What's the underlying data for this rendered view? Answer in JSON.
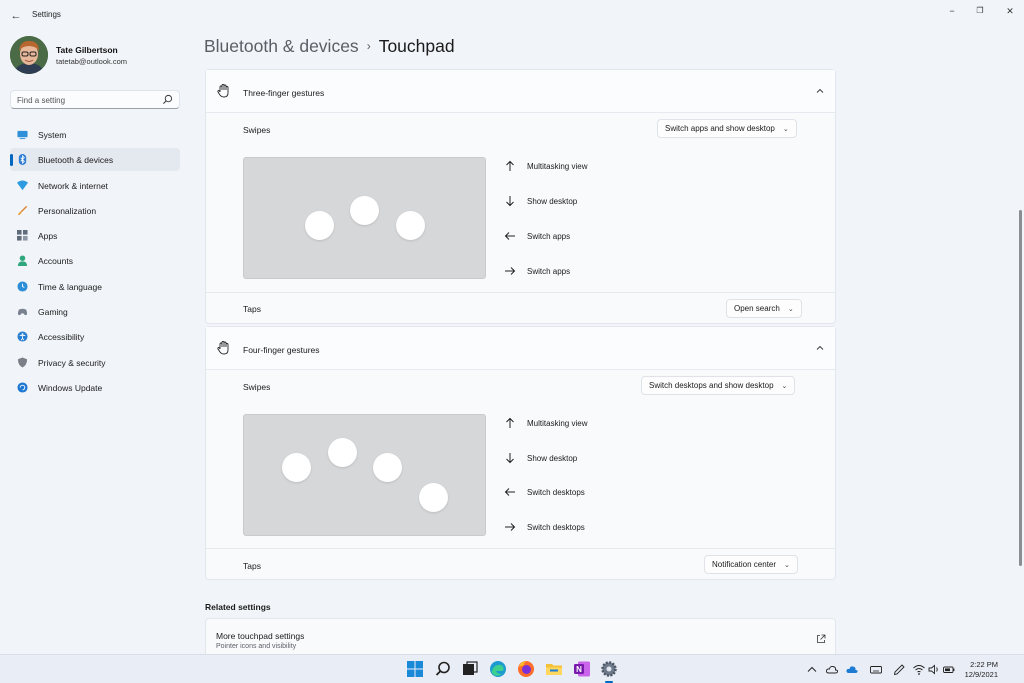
{
  "window": {
    "title": "Settings",
    "back_glyph": "←",
    "minimize_glyph": "−",
    "maximize_glyph": "❐",
    "close_glyph": "✕"
  },
  "profile": {
    "name": "Tate Gilbertson",
    "email": "tatetab@outlook.com"
  },
  "search": {
    "placeholder": "Find a setting"
  },
  "sidebar": {
    "items": [
      {
        "label": "System",
        "icon": "system-icon",
        "color": "#2f8fd8"
      },
      {
        "label": "Bluetooth & devices",
        "icon": "bluetooth-icon",
        "color": "#2b7bd4",
        "active": true
      },
      {
        "label": "Network & internet",
        "icon": "network-icon",
        "color": "#2e9be0"
      },
      {
        "label": "Personalization",
        "icon": "brush-icon",
        "color": "#d9822b"
      },
      {
        "label": "Apps",
        "icon": "apps-icon",
        "color": "#5f6b7a"
      },
      {
        "label": "Accounts",
        "icon": "accounts-icon",
        "color": "#2fa67c"
      },
      {
        "label": "Time & language",
        "icon": "time-language-icon",
        "color": "#2c8ed6"
      },
      {
        "label": "Gaming",
        "icon": "gaming-icon",
        "color": "#7a8290"
      },
      {
        "label": "Accessibility",
        "icon": "accessibility-icon",
        "color": "#2a7fd0"
      },
      {
        "label": "Privacy & security",
        "icon": "shield-icon",
        "color": "#7b8088"
      },
      {
        "label": "Windows Update",
        "icon": "update-icon",
        "color": "#1f78d1"
      }
    ]
  },
  "breadcrumb": {
    "parent": "Bluetooth & devices",
    "separator": "›",
    "current": "Touchpad"
  },
  "three_finger": {
    "title": "Three-finger gestures",
    "swipes_label": "Swipes",
    "swipes_value": "Switch apps and show desktop",
    "gestures": [
      {
        "direction": "up",
        "arrow": "↑",
        "label": "Multitasking view"
      },
      {
        "direction": "down",
        "arrow": "↓",
        "label": "Show desktop"
      },
      {
        "direction": "left",
        "arrow": "←",
        "label": "Switch apps"
      },
      {
        "direction": "right",
        "arrow": "→",
        "label": "Switch apps"
      }
    ],
    "taps_label": "Taps",
    "taps_value": "Open search"
  },
  "four_finger": {
    "title": "Four-finger gestures",
    "swipes_label": "Swipes",
    "swipes_value": "Switch desktops and show desktop",
    "gestures": [
      {
        "direction": "up",
        "arrow": "↑",
        "label": "Multitasking view"
      },
      {
        "direction": "down",
        "arrow": "↓",
        "label": "Show desktop"
      },
      {
        "direction": "left",
        "arrow": "←",
        "label": "Switch desktops"
      },
      {
        "direction": "right",
        "arrow": "→",
        "label": "Switch desktops"
      }
    ],
    "taps_label": "Taps",
    "taps_value": "Notification center"
  },
  "related": {
    "title": "Related settings",
    "items": [
      {
        "title": "More touchpad settings",
        "subtitle": "Pointer icons and visibility",
        "icon": "open-external-icon"
      }
    ]
  },
  "taskbar": {
    "apps": [
      {
        "name": "start",
        "icon": "windows-start-icon"
      },
      {
        "name": "search",
        "icon": "search-icon"
      },
      {
        "name": "task-view",
        "icon": "task-view-icon"
      },
      {
        "name": "edge",
        "icon": "edge-icon"
      },
      {
        "name": "firefox",
        "icon": "firefox-icon"
      },
      {
        "name": "file-explorer",
        "icon": "folder-icon"
      },
      {
        "name": "onenote",
        "icon": "onenote-icon"
      },
      {
        "name": "settings",
        "icon": "gear-icon",
        "active": true
      }
    ],
    "tray": [
      "chevron-up-icon",
      "cloud-icon",
      "onedrive-icon",
      "keyboard-icon",
      "pen-icon",
      "wifi-icon",
      "volume-icon",
      "battery-icon"
    ],
    "time": "2:22 PM",
    "date": "12/9/2021"
  },
  "colors": {
    "accent": "#0067c0",
    "background": "#f1f4f9",
    "card": "#f9fafc"
  }
}
